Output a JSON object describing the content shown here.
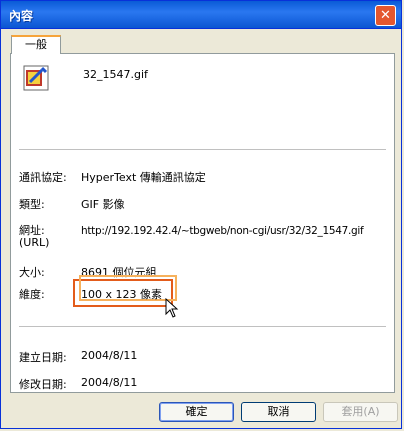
{
  "window": {
    "title": "內容"
  },
  "tab": {
    "label": "一般"
  },
  "file": {
    "name": "32_1547.gif",
    "icon": "gif-image-file-icon"
  },
  "rows": {
    "protocol_label": "通訊協定:",
    "protocol_value": "HyperText 傳輸通訊協定",
    "type_label": "類型:",
    "type_value": "GIF 影像",
    "address_label": "網址:",
    "address_label2": "(URL)",
    "address_value": "http://192.192.42.4/~tbgweb/non-cgi/usr/32/32_1547.gif",
    "size_label": "大小:",
    "size_value": "8691 個位元組",
    "dimension_label": "維度:",
    "dimension_value": "100 x 123 像素",
    "created_label": "建立日期:",
    "created_value": "2004/8/11",
    "modified_label": "修改日期:",
    "modified_value": "2004/8/11"
  },
  "buttons": {
    "ok": "確定",
    "cancel": "取消",
    "apply": "套用(A)"
  },
  "colors": {
    "titlebar": "#0a5bd6",
    "highlight": "#e35c1b"
  }
}
